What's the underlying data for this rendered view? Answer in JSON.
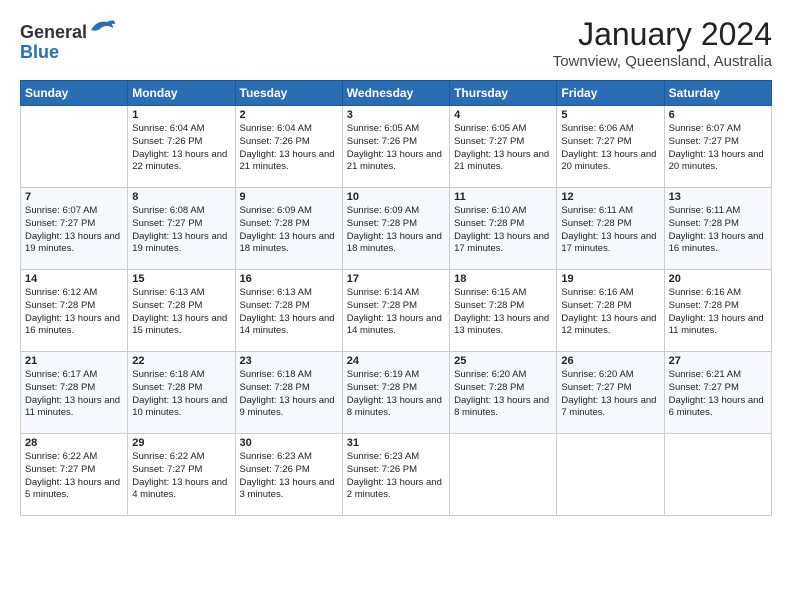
{
  "logo": {
    "general": "General",
    "blue": "Blue"
  },
  "header": {
    "month_year": "January 2024",
    "location": "Townview, Queensland, Australia"
  },
  "weekdays": [
    "Sunday",
    "Monday",
    "Tuesday",
    "Wednesday",
    "Thursday",
    "Friday",
    "Saturday"
  ],
  "weeks": [
    [
      {
        "day": "",
        "sunrise": "",
        "sunset": "",
        "daylight": ""
      },
      {
        "day": "1",
        "sunrise": "Sunrise: 6:04 AM",
        "sunset": "Sunset: 7:26 PM",
        "daylight": "Daylight: 13 hours and 22 minutes."
      },
      {
        "day": "2",
        "sunrise": "Sunrise: 6:04 AM",
        "sunset": "Sunset: 7:26 PM",
        "daylight": "Daylight: 13 hours and 21 minutes."
      },
      {
        "day": "3",
        "sunrise": "Sunrise: 6:05 AM",
        "sunset": "Sunset: 7:26 PM",
        "daylight": "Daylight: 13 hours and 21 minutes."
      },
      {
        "day": "4",
        "sunrise": "Sunrise: 6:05 AM",
        "sunset": "Sunset: 7:27 PM",
        "daylight": "Daylight: 13 hours and 21 minutes."
      },
      {
        "day": "5",
        "sunrise": "Sunrise: 6:06 AM",
        "sunset": "Sunset: 7:27 PM",
        "daylight": "Daylight: 13 hours and 20 minutes."
      },
      {
        "day": "6",
        "sunrise": "Sunrise: 6:07 AM",
        "sunset": "Sunset: 7:27 PM",
        "daylight": "Daylight: 13 hours and 20 minutes."
      }
    ],
    [
      {
        "day": "7",
        "sunrise": "Sunrise: 6:07 AM",
        "sunset": "Sunset: 7:27 PM",
        "daylight": "Daylight: 13 hours and 19 minutes."
      },
      {
        "day": "8",
        "sunrise": "Sunrise: 6:08 AM",
        "sunset": "Sunset: 7:27 PM",
        "daylight": "Daylight: 13 hours and 19 minutes."
      },
      {
        "day": "9",
        "sunrise": "Sunrise: 6:09 AM",
        "sunset": "Sunset: 7:28 PM",
        "daylight": "Daylight: 13 hours and 18 minutes."
      },
      {
        "day": "10",
        "sunrise": "Sunrise: 6:09 AM",
        "sunset": "Sunset: 7:28 PM",
        "daylight": "Daylight: 13 hours and 18 minutes."
      },
      {
        "day": "11",
        "sunrise": "Sunrise: 6:10 AM",
        "sunset": "Sunset: 7:28 PM",
        "daylight": "Daylight: 13 hours and 17 minutes."
      },
      {
        "day": "12",
        "sunrise": "Sunrise: 6:11 AM",
        "sunset": "Sunset: 7:28 PM",
        "daylight": "Daylight: 13 hours and 17 minutes."
      },
      {
        "day": "13",
        "sunrise": "Sunrise: 6:11 AM",
        "sunset": "Sunset: 7:28 PM",
        "daylight": "Daylight: 13 hours and 16 minutes."
      }
    ],
    [
      {
        "day": "14",
        "sunrise": "Sunrise: 6:12 AM",
        "sunset": "Sunset: 7:28 PM",
        "daylight": "Daylight: 13 hours and 16 minutes."
      },
      {
        "day": "15",
        "sunrise": "Sunrise: 6:13 AM",
        "sunset": "Sunset: 7:28 PM",
        "daylight": "Daylight: 13 hours and 15 minutes."
      },
      {
        "day": "16",
        "sunrise": "Sunrise: 6:13 AM",
        "sunset": "Sunset: 7:28 PM",
        "daylight": "Daylight: 13 hours and 14 minutes."
      },
      {
        "day": "17",
        "sunrise": "Sunrise: 6:14 AM",
        "sunset": "Sunset: 7:28 PM",
        "daylight": "Daylight: 13 hours and 14 minutes."
      },
      {
        "day": "18",
        "sunrise": "Sunrise: 6:15 AM",
        "sunset": "Sunset: 7:28 PM",
        "daylight": "Daylight: 13 hours and 13 minutes."
      },
      {
        "day": "19",
        "sunrise": "Sunrise: 6:16 AM",
        "sunset": "Sunset: 7:28 PM",
        "daylight": "Daylight: 13 hours and 12 minutes."
      },
      {
        "day": "20",
        "sunrise": "Sunrise: 6:16 AM",
        "sunset": "Sunset: 7:28 PM",
        "daylight": "Daylight: 13 hours and 11 minutes."
      }
    ],
    [
      {
        "day": "21",
        "sunrise": "Sunrise: 6:17 AM",
        "sunset": "Sunset: 7:28 PM",
        "daylight": "Daylight: 13 hours and 11 minutes."
      },
      {
        "day": "22",
        "sunrise": "Sunrise: 6:18 AM",
        "sunset": "Sunset: 7:28 PM",
        "daylight": "Daylight: 13 hours and 10 minutes."
      },
      {
        "day": "23",
        "sunrise": "Sunrise: 6:18 AM",
        "sunset": "Sunset: 7:28 PM",
        "daylight": "Daylight: 13 hours and 9 minutes."
      },
      {
        "day": "24",
        "sunrise": "Sunrise: 6:19 AM",
        "sunset": "Sunset: 7:28 PM",
        "daylight": "Daylight: 13 hours and 8 minutes."
      },
      {
        "day": "25",
        "sunrise": "Sunrise: 6:20 AM",
        "sunset": "Sunset: 7:28 PM",
        "daylight": "Daylight: 13 hours and 8 minutes."
      },
      {
        "day": "26",
        "sunrise": "Sunrise: 6:20 AM",
        "sunset": "Sunset: 7:27 PM",
        "daylight": "Daylight: 13 hours and 7 minutes."
      },
      {
        "day": "27",
        "sunrise": "Sunrise: 6:21 AM",
        "sunset": "Sunset: 7:27 PM",
        "daylight": "Daylight: 13 hours and 6 minutes."
      }
    ],
    [
      {
        "day": "28",
        "sunrise": "Sunrise: 6:22 AM",
        "sunset": "Sunset: 7:27 PM",
        "daylight": "Daylight: 13 hours and 5 minutes."
      },
      {
        "day": "29",
        "sunrise": "Sunrise: 6:22 AM",
        "sunset": "Sunset: 7:27 PM",
        "daylight": "Daylight: 13 hours and 4 minutes."
      },
      {
        "day": "30",
        "sunrise": "Sunrise: 6:23 AM",
        "sunset": "Sunset: 7:26 PM",
        "daylight": "Daylight: 13 hours and 3 minutes."
      },
      {
        "day": "31",
        "sunrise": "Sunrise: 6:23 AM",
        "sunset": "Sunset: 7:26 PM",
        "daylight": "Daylight: 13 hours and 2 minutes."
      },
      {
        "day": "",
        "sunrise": "",
        "sunset": "",
        "daylight": ""
      },
      {
        "day": "",
        "sunrise": "",
        "sunset": "",
        "daylight": ""
      },
      {
        "day": "",
        "sunrise": "",
        "sunset": "",
        "daylight": ""
      }
    ]
  ]
}
